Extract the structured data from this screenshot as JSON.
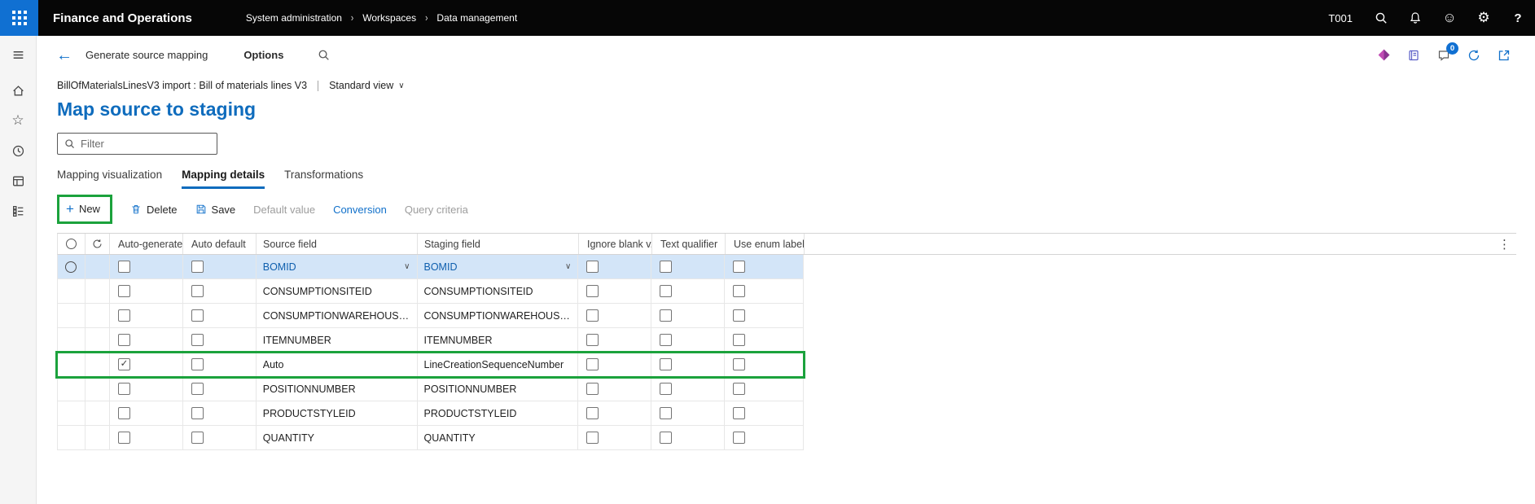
{
  "icons": {
    "back": "←",
    "caret_down": "∨",
    "plus": "+",
    "ellipsis_v": "⋮",
    "check": "✓",
    "star": "☆",
    "gear": "⚙",
    "smiley": "☺",
    "help": "?",
    "chevron_right": "›"
  },
  "colors": {
    "accent_blue": "#0f6cbd",
    "top_bar_black": "#060606",
    "app_launcher_blue": "#1070d2",
    "selected_row_blue": "#d3e5f8",
    "annotation_green": "#1ba23c"
  },
  "top_bar": {
    "app_title": "Finance and Operations",
    "breadcrumb": [
      {
        "label": "System administration"
      },
      {
        "label": "Workspaces"
      },
      {
        "label": "Data management"
      }
    ],
    "company": "T001"
  },
  "action_pane": {
    "form_title": "Generate source mapping",
    "menu_tab": "Options",
    "notification_count": "0"
  },
  "page": {
    "record_title": "BillOfMaterialsLinesV3 import : Bill of materials lines V3",
    "view_name": "Standard view",
    "title": "Map source to staging",
    "filter_placeholder": "Filter"
  },
  "tabs": [
    {
      "label": "Mapping visualization",
      "active": false
    },
    {
      "label": "Mapping details",
      "active": true
    },
    {
      "label": "Transformations",
      "active": false
    }
  ],
  "toolbar": {
    "new": "New",
    "delete": "Delete",
    "save": "Save",
    "default_value": "Default value",
    "conversion": "Conversion",
    "query_criteria": "Query criteria"
  },
  "grid": {
    "columns": {
      "auto_generated": "Auto-generated",
      "auto_default": "Auto default",
      "source_field": "Source field",
      "staging_field": "Staging field",
      "ignore_blank": "Ignore blank v...",
      "text_qualifier": "Text qualifier",
      "use_enum_label": "Use enum label"
    },
    "rows": [
      {
        "auto_generated": false,
        "auto_default": false,
        "source_field": "BOMID",
        "staging_field": "BOMID",
        "ignore_blank": false,
        "text_qualifier": false,
        "use_enum_label": false,
        "selected": true,
        "annotated": false
      },
      {
        "auto_generated": false,
        "auto_default": false,
        "source_field": "CONSUMPTIONSITEID",
        "staging_field": "CONSUMPTIONSITEID",
        "ignore_blank": false,
        "text_qualifier": false,
        "use_enum_label": false,
        "selected": false,
        "annotated": false
      },
      {
        "auto_generated": false,
        "auto_default": false,
        "source_field": "CONSUMPTIONWAREHOUSEID",
        "staging_field": "CONSUMPTIONWAREHOUSEID",
        "ignore_blank": false,
        "text_qualifier": false,
        "use_enum_label": false,
        "selected": false,
        "annotated": false
      },
      {
        "auto_generated": false,
        "auto_default": false,
        "source_field": "ITEMNUMBER",
        "staging_field": "ITEMNUMBER",
        "ignore_blank": false,
        "text_qualifier": false,
        "use_enum_label": false,
        "selected": false,
        "annotated": false
      },
      {
        "auto_generated": true,
        "auto_default": false,
        "source_field": "Auto",
        "staging_field": "LineCreationSequenceNumber",
        "ignore_blank": false,
        "text_qualifier": false,
        "use_enum_label": false,
        "selected": false,
        "annotated": true
      },
      {
        "auto_generated": false,
        "auto_default": false,
        "source_field": "POSITIONNUMBER",
        "staging_field": "POSITIONNUMBER",
        "ignore_blank": false,
        "text_qualifier": false,
        "use_enum_label": false,
        "selected": false,
        "annotated": false
      },
      {
        "auto_generated": false,
        "auto_default": false,
        "source_field": "PRODUCTSTYLEID",
        "staging_field": "PRODUCTSTYLEID",
        "ignore_blank": false,
        "text_qualifier": false,
        "use_enum_label": false,
        "selected": false,
        "annotated": false
      },
      {
        "auto_generated": false,
        "auto_default": false,
        "source_field": "QUANTITY",
        "staging_field": "QUANTITY",
        "ignore_blank": false,
        "text_qualifier": false,
        "use_enum_label": false,
        "selected": false,
        "annotated": false
      }
    ]
  }
}
